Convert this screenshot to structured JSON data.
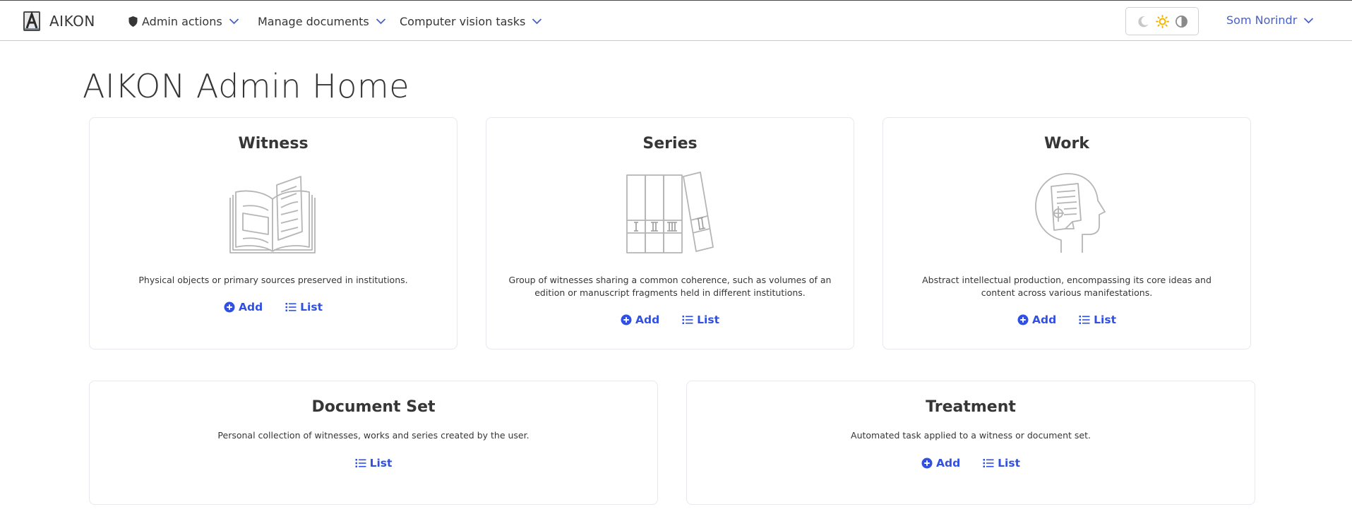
{
  "brand": {
    "name": "AIKON",
    "logo_icon": "aikon-logo-icon"
  },
  "nav": {
    "admin_actions": {
      "label": "Admin actions",
      "icon": "shield-icon"
    },
    "manage_documents": {
      "label": "Manage documents"
    },
    "cv_tasks": {
      "label": "Computer vision tasks"
    }
  },
  "theme_switcher": {
    "options": [
      "moon-icon",
      "sun-icon",
      "contrast-icon"
    ],
    "active": "sun-icon",
    "active_color": "#f0b400"
  },
  "user": {
    "name": "Som Norindr"
  },
  "page": {
    "title": "AIKON Admin Home"
  },
  "cards": {
    "witness": {
      "title": "Witness",
      "icon": "open-book-icon",
      "description": "Physical objects or primary sources preserved in institutions.",
      "add_label": "Add",
      "list_label": "List"
    },
    "series": {
      "title": "Series",
      "icon": "book-volumes-icon",
      "description": "Group of witnesses sharing a common coherence, such as volumes of an edition or manuscript fragments held in different institutions.",
      "add_label": "Add",
      "list_label": "List"
    },
    "work": {
      "title": "Work",
      "icon": "head-document-icon",
      "description": "Abstract intellectual production, encompassing its core ideas and content across various manifestations.",
      "add_label": "Add",
      "list_label": "List"
    },
    "document_set": {
      "title": "Document Set",
      "description": "Personal collection of witnesses, works and series created by the user.",
      "list_label": "List"
    },
    "treatment": {
      "title": "Treatment",
      "description": "Automated task applied to a witness or document set.",
      "add_label": "Add",
      "list_label": "List"
    }
  },
  "colors": {
    "link": "#3050e4",
    "user_link": "#485fc7",
    "text": "#363636"
  }
}
